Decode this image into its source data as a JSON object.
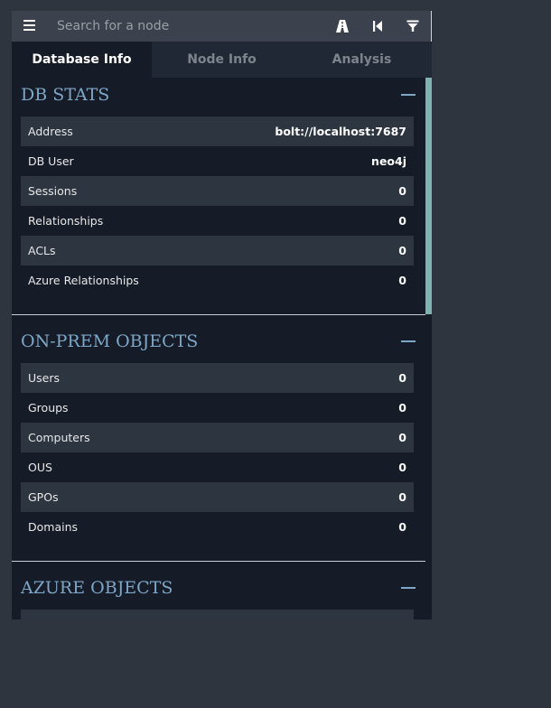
{
  "search": {
    "placeholder": "Search for a node"
  },
  "toolbar": {
    "icons": [
      "menu-icon",
      "pathfinding-icon",
      "back-icon",
      "filter-icon"
    ]
  },
  "tabs": [
    {
      "label": "Database Info",
      "active": true
    },
    {
      "label": "Node Info",
      "active": false
    },
    {
      "label": "Analysis",
      "active": false
    }
  ],
  "sections": {
    "db_stats": {
      "title": "DB STATS",
      "rows": [
        {
          "label": "Address",
          "value": "bolt://localhost:7687"
        },
        {
          "label": "DB User",
          "value": "neo4j"
        },
        {
          "label": "Sessions",
          "value": "0"
        },
        {
          "label": "Relationships",
          "value": "0"
        },
        {
          "label": "ACLs",
          "value": "0"
        },
        {
          "label": "Azure Relationships",
          "value": "0"
        }
      ]
    },
    "onprem": {
      "title": "ON-PREM OBJECTS",
      "rows": [
        {
          "label": "Users",
          "value": "0"
        },
        {
          "label": "Groups",
          "value": "0"
        },
        {
          "label": "Computers",
          "value": "0"
        },
        {
          "label": "OUS",
          "value": "0"
        },
        {
          "label": "GPOs",
          "value": "0"
        },
        {
          "label": "Domains",
          "value": "0"
        }
      ]
    },
    "azure": {
      "title": "AZURE OBJECTS"
    }
  },
  "colors": {
    "accent": "#7ea6c6",
    "panel_bg": "#151c27",
    "row_alt": "#2d3540",
    "scrollbar": "#7fb3b1"
  }
}
